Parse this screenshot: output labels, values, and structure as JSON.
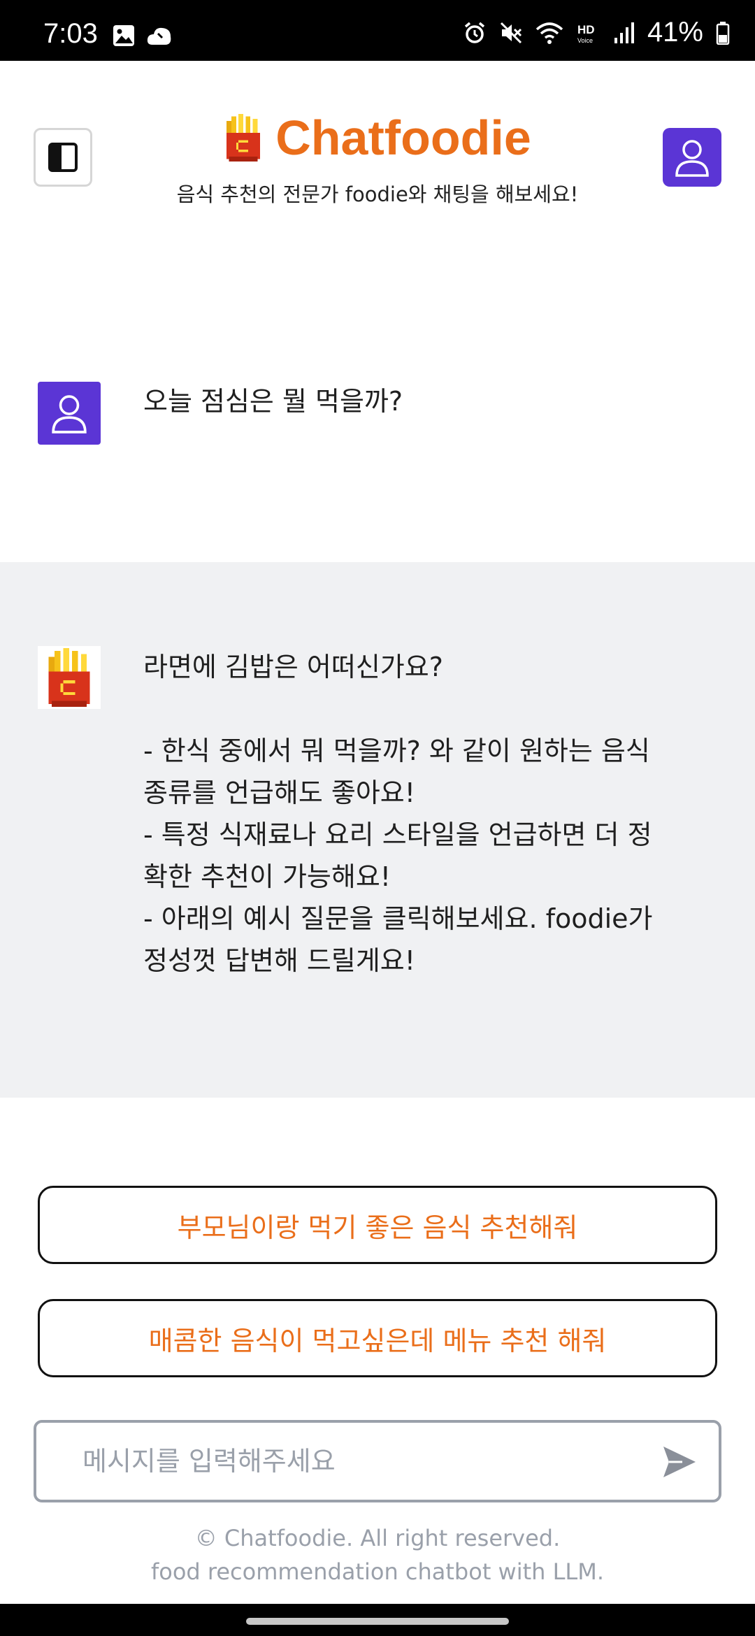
{
  "status_bar": {
    "time": "7:03",
    "battery": "41%",
    "icons": [
      "image-icon",
      "cloud-icon",
      "alarm-icon",
      "mute-icon",
      "wifi-icon",
      "hd-voice-icon",
      "signal-icon",
      "battery-icon"
    ]
  },
  "header": {
    "title": "Chatfoodie",
    "subtitle": "음식 추천의 전문가 foodie와 채팅을 해보세요!",
    "brand_color": "#ea6e1a",
    "accent_color": "#5b35d5"
  },
  "messages": [
    {
      "role": "user",
      "text": "오늘 점심은 뭘 먹을까?"
    },
    {
      "role": "bot",
      "text": "라면에 김밥은 어떠신가요?\n\n- 한식 중에서 뭐 먹을까? 와 같이 원하는 음식\n종류를 언급해도 좋아요!\n- 특정 식재료나 요리 스타일을 언급하면 더 정\n확한 추천이 가능해요!\n- 아래의 예시 질문을 클릭해보세요. foodie가\n정성껏 답변해 드릴게요!"
    }
  ],
  "suggestions": [
    "부모님이랑 먹기 좋은 음식 추천해줘",
    "매콤한 음식이 먹고싶은데 메뉴 추천 해줘"
  ],
  "input": {
    "placeholder": "메시지를 입력해주세요",
    "value": ""
  },
  "footer": {
    "line1": "© Chatfoodie. All right reserved.",
    "line2": "food recommendation chatbot with LLM."
  }
}
